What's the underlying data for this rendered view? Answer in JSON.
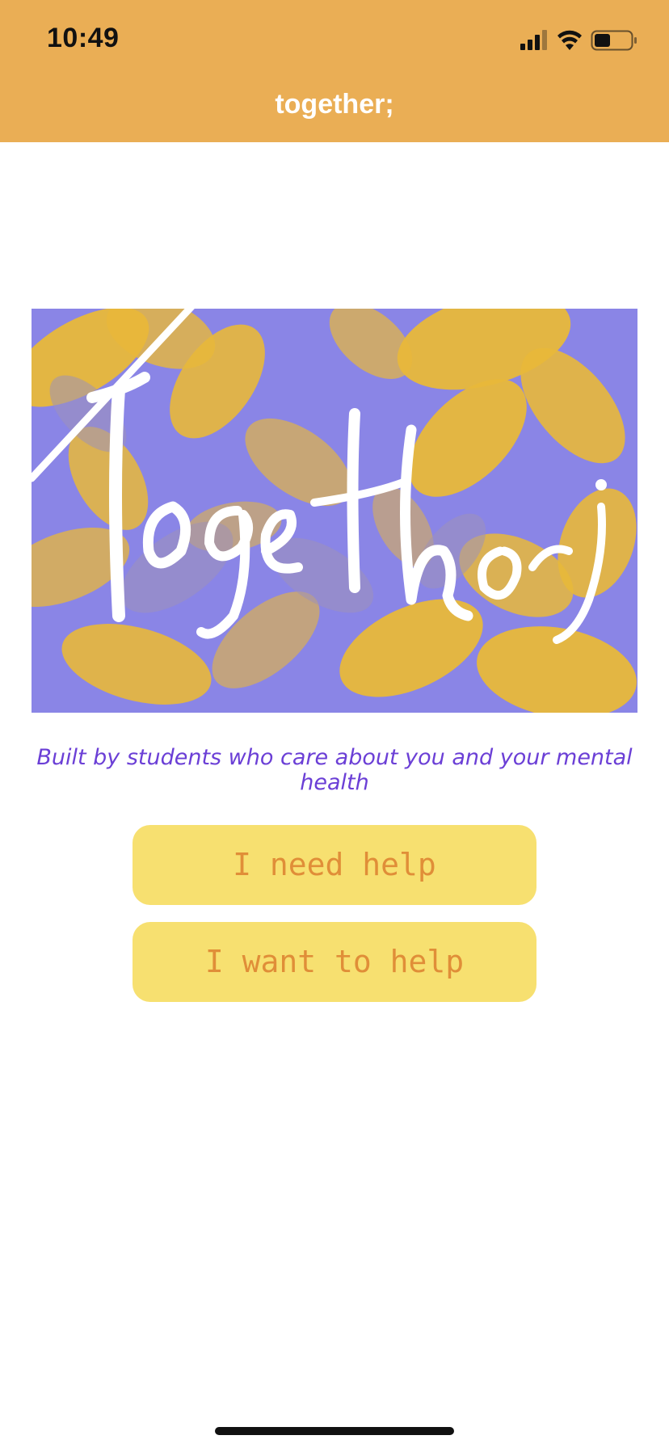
{
  "status_bar": {
    "time": "10:49",
    "icons": [
      "signal-icon",
      "wifi-icon",
      "battery-icon"
    ]
  },
  "nav": {
    "title": "together;"
  },
  "hero": {
    "wordmark": "Together;",
    "background_color": "#8A85E6",
    "leaf_color": "#E8B83A"
  },
  "tagline": "Built by students who care about you and your mental health",
  "buttons": {
    "need_help": "I need help",
    "want_to_help": "I want to help"
  },
  "colors": {
    "header": "#EAAE55",
    "button_bg": "#F7E070",
    "button_text": "#E08E38",
    "tagline_text": "#6B3FD6"
  }
}
